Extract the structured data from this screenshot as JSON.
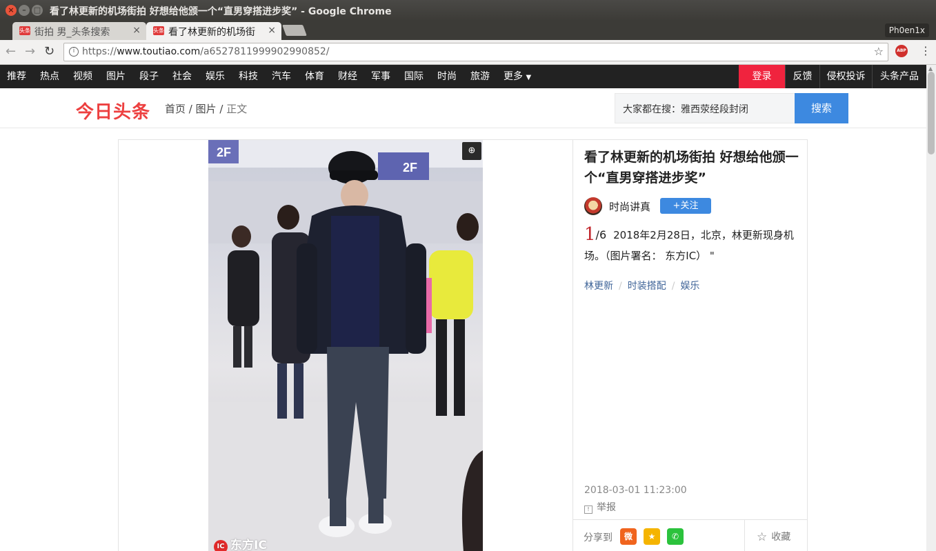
{
  "window": {
    "title": "看了林更新的机场街拍 好想给他颁一个“直男穿搭进步奖” - Google Chrome",
    "profile": "Ph0en1x"
  },
  "tabs": [
    {
      "label": "街拍 男_头条搜索",
      "favicon": "头条"
    },
    {
      "label": "看了林更新的机场街",
      "favicon": "头条",
      "active": true
    }
  ],
  "toolbar": {
    "url_scheme": "https://",
    "url_host": "www.toutiao.com",
    "url_path": "/a6527811999902990852/",
    "abp": "ABP"
  },
  "sitenav": {
    "items": [
      "推荐",
      "热点",
      "视频",
      "图片",
      "段子",
      "社会",
      "娱乐",
      "科技",
      "汽车",
      "体育",
      "财经",
      "军事",
      "国际",
      "时尚",
      "旅游",
      "更多"
    ],
    "login": "登录",
    "feedback": "反馈",
    "complaint": "侵权投诉",
    "products": "头条产品"
  },
  "header": {
    "logo": "今日头条",
    "breadcrumb": {
      "home": "首页",
      "sep1": " / ",
      "pics": "图片",
      "sep2": " / ",
      "current": "正文"
    },
    "search_placeholder": "大家都在搜：雅西荥经段封闭",
    "search_button": "搜索"
  },
  "gallery": {
    "watermark_ic": "IC",
    "watermark": "东方IC"
  },
  "article": {
    "title": "看了林更新的机场街拍 好想给他颁一个“直男穿搭进步奖”",
    "author": "时尚讲真",
    "follow": "+关注",
    "current_index": "1",
    "total": "/6",
    "description": "2018年2月28日，北京，林更新现身机场。（图片署名： 东方IC） \"",
    "tags": [
      "林更新",
      "时装搭配",
      "娱乐"
    ],
    "time": "2018-03-01 11:23:00",
    "report": "举报",
    "share_label": "分享到",
    "collect": "收藏"
  },
  "colors": {
    "brand_red": "#f0233e",
    "accent_blue": "#3d89e0",
    "nav_bg": "#222222",
    "tag_blue": "#406599"
  }
}
